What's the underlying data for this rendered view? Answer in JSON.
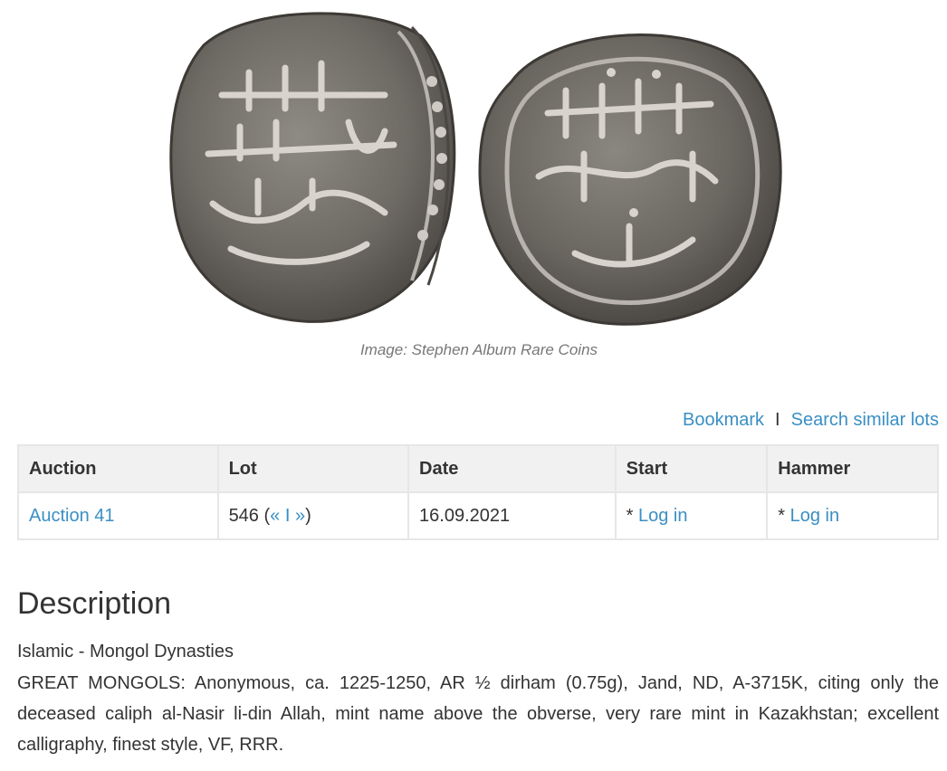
{
  "image": {
    "caption": "Image: Stephen Album Rare Coins"
  },
  "actions": {
    "bookmark": "Bookmark",
    "separator": "I",
    "search_similar": "Search similar lots"
  },
  "table": {
    "headers": {
      "auction": "Auction",
      "lot": "Lot",
      "date": "Date",
      "start": "Start",
      "hammer": "Hammer"
    },
    "row": {
      "auction": "Auction 41",
      "lot_number": "546",
      "lot_open": "(",
      "prev": "«",
      "nav_sep": "I",
      "next": "»",
      "lot_close": ")",
      "date": "16.09.2021",
      "start_prefix": "* ",
      "start_link": "Log in",
      "hammer_prefix": "* ",
      "hammer_link": "Log in"
    }
  },
  "description": {
    "heading": "Description",
    "category": "Islamic - Mongol Dynasties",
    "text": "GREAT MONGOLS: Anonymous, ca. 1225-1250, AR ½ dirham (0.75g), Jand, ND, A-3715K, citing only the deceased caliph al-Nasir li-din Allah, mint name above the obverse, very rare mint in Kazakhstan; excellent calligraphy, finest style, VF, RRR."
  }
}
